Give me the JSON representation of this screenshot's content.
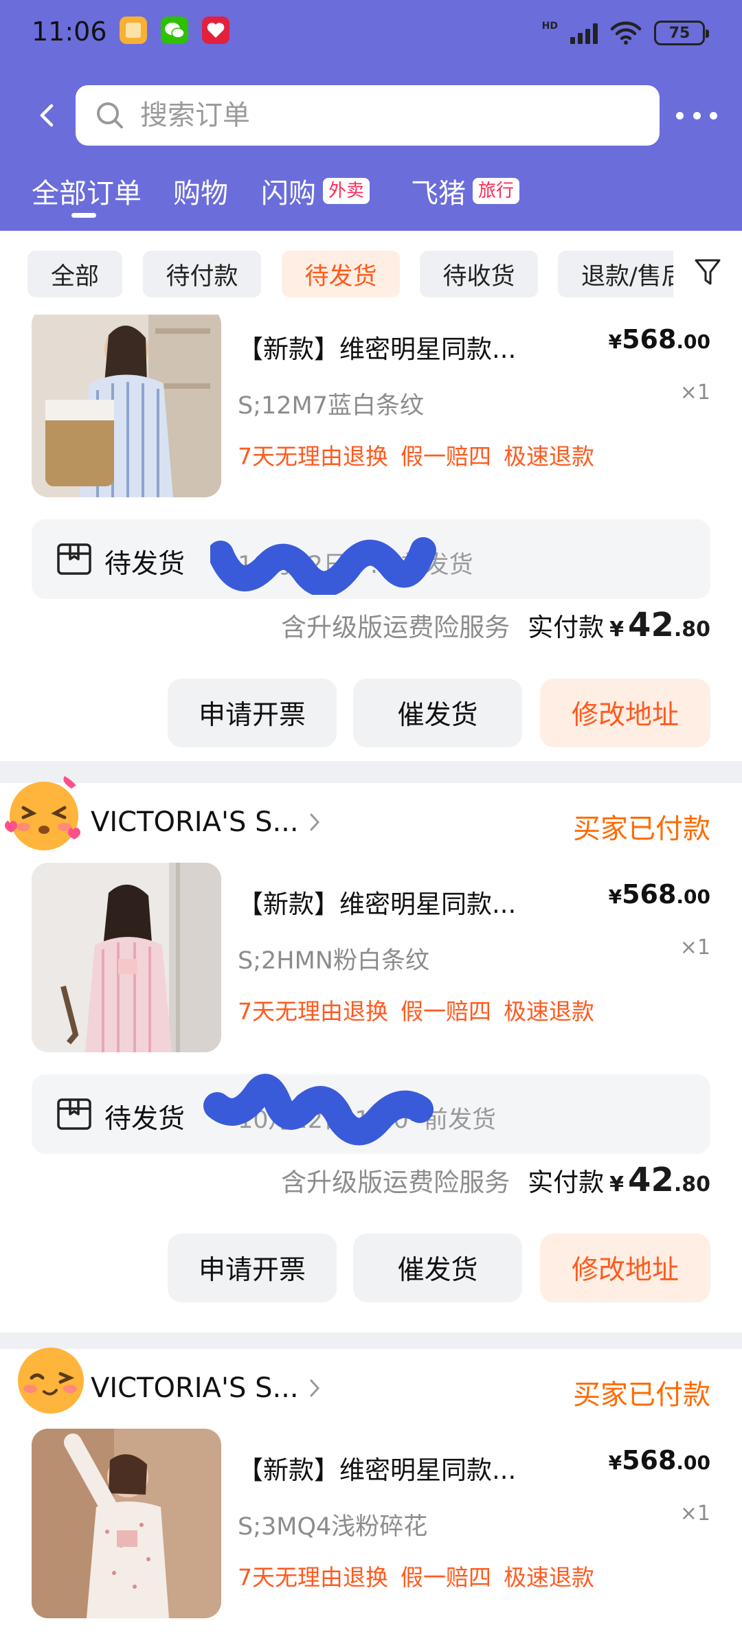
{
  "status_bar": {
    "time": "11:06",
    "network": "HD",
    "battery": "75"
  },
  "search": {
    "placeholder": "搜索订单"
  },
  "top_tabs": [
    {
      "label": "全部订单",
      "badge": ""
    },
    {
      "label": "购物",
      "badge": ""
    },
    {
      "label": "闪购",
      "badge": "外卖"
    },
    {
      "label": "飞猪",
      "badge": "旅行"
    }
  ],
  "filters": [
    {
      "label": "全部"
    },
    {
      "label": "待付款"
    },
    {
      "label": "待发货"
    },
    {
      "label": "待收货"
    },
    {
      "label": "退款/售后"
    }
  ],
  "orders": [
    {
      "shop": "",
      "status": "",
      "product": {
        "title": "【新款】维密明星同款...",
        "price_int": "568",
        "price_dec": ".00",
        "spec": "S;12M7蓝白条纹",
        "qty": "×1",
        "tags": [
          "7天无理由退换",
          "假一赔四",
          "极速退款"
        ]
      },
      "shipping": {
        "label": "待发货",
        "detail": "10月22日 ··:·· 前发货"
      },
      "payment": {
        "service": "含升级版运费险服务",
        "label": "实付款",
        "yen": "¥",
        "int": "42",
        "dec": ".80"
      },
      "buttons": [
        "申请开票",
        "催发货",
        "修改地址"
      ]
    },
    {
      "shop": "VICTORIA'S S...",
      "status": "买家已付款",
      "product": {
        "title": "【新款】维密明星同款...",
        "price_int": "568",
        "price_dec": ".00",
        "spec": "S;2HMN粉白条纹",
        "qty": "×1",
        "tags": [
          "7天无理由退换",
          "假一赔四",
          "极速退款"
        ]
      },
      "shipping": {
        "label": "待发货",
        "detail": "10月22日 11:0· 前发货"
      },
      "payment": {
        "service": "含升级版运费险服务",
        "label": "实付款",
        "yen": "¥",
        "int": "42",
        "dec": ".80"
      },
      "buttons": [
        "申请开票",
        "催发货",
        "修改地址"
      ]
    },
    {
      "shop": "VICTORIA'S S...",
      "status": "买家已付款",
      "product": {
        "title": "【新款】维密明星同款...",
        "price_int": "568",
        "price_dec": ".00",
        "spec": "S;3MQ4浅粉碎花",
        "qty": "×1",
        "tags": [
          "7天无理由退换",
          "假一赔四",
          "极速退款"
        ]
      }
    }
  ],
  "price_yen": "¥",
  "colors": {
    "header": "#6b6ddb",
    "accent": "#ff5a1e",
    "chip_bg": "#eef0f3",
    "redaction": "#3a5bd9"
  }
}
